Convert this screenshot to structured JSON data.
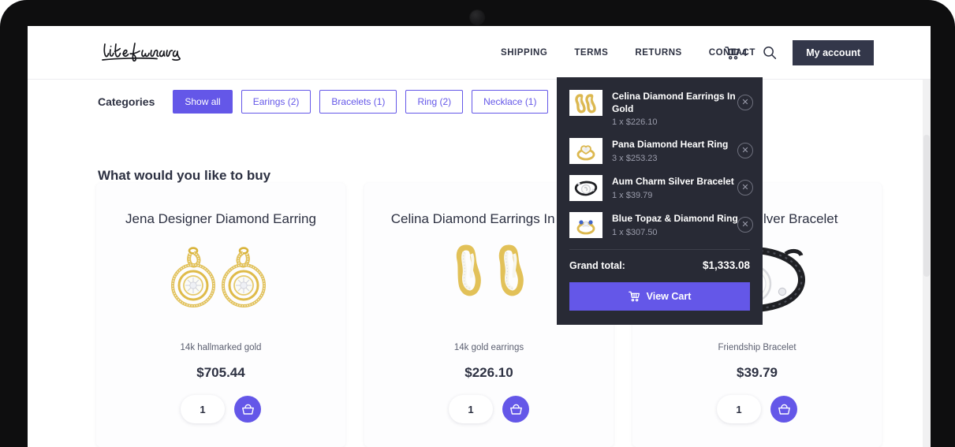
{
  "device": {
    "frame": "tablet",
    "camera_icon": "camera-lens"
  },
  "header": {
    "logo_text": "likeLaura",
    "nav": [
      {
        "label": "SHIPPING"
      },
      {
        "label": "TERMS"
      },
      {
        "label": "RETURNS"
      },
      {
        "label": "CONTACT"
      }
    ],
    "cart_icon": "shopping-cart-icon",
    "cart_count": "4",
    "search_icon": "search-icon",
    "account_label": "My account"
  },
  "categories": {
    "label": "Categories",
    "chips": [
      {
        "label": "Show all",
        "active": true
      },
      {
        "label": "Earings (2)",
        "active": false
      },
      {
        "label": "Bracelets (1)",
        "active": false
      },
      {
        "label": "Ring (2)",
        "active": false
      },
      {
        "label": "Necklace (1)",
        "active": false
      }
    ]
  },
  "main": {
    "heading": "What would you like to buy",
    "products": [
      {
        "title": "Jena Designer Diamond Earring",
        "image": "gold-diamond-circle-earrings",
        "subtitle": "14k hallmarked gold",
        "price": "$705.44",
        "quantity": "1",
        "add_icon": "basket-icon"
      },
      {
        "title": "Celina Diamond Earrings In Gold",
        "image": "gold-twist-diamond-earrings",
        "subtitle": "14k gold earrings",
        "price": "$226.10",
        "quantity": "1",
        "add_icon": "basket-icon"
      },
      {
        "title": "Aum Charm Silver Bracelet",
        "image": "black-cord-silver-charm-bracelet",
        "subtitle": "Friendship Bracelet",
        "price": "$39.79",
        "quantity": "1",
        "add_icon": "basket-icon"
      }
    ]
  },
  "cart_dropdown": {
    "items": [
      {
        "name": "Celina Diamond Earrings In Gold",
        "qty_price": "1 x $226.10",
        "thumb": "gold-twist-diamond-earrings",
        "remove_icon": "close-icon"
      },
      {
        "name": "Pana Diamond Heart Ring",
        "qty_price": "3 x $253.23",
        "thumb": "gold-heart-diamond-ring",
        "remove_icon": "close-icon"
      },
      {
        "name": "Aum Charm Silver Bracelet",
        "qty_price": "1 x $39.79",
        "thumb": "black-cord-silver-charm-bracelet",
        "remove_icon": "close-icon"
      },
      {
        "name": "Blue Topaz & Diamond Ring",
        "qty_price": "1 x $307.50",
        "thumb": "blue-topaz-diamond-ring",
        "remove_icon": "close-icon"
      }
    ],
    "total_label": "Grand total:",
    "total_value": "$1,333.08",
    "view_cart_label": "View Cart",
    "view_cart_icon": "cart-icon"
  },
  "colors": {
    "accent_purple": "#6457e8",
    "dark_navy": "#33374a",
    "cart_panel": "#282a35",
    "text_dark": "#2d3142"
  }
}
